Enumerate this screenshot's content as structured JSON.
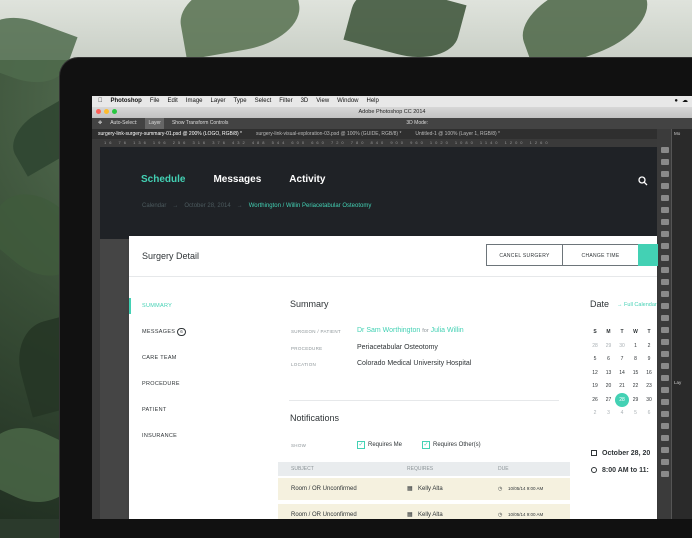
{
  "mac_menu": {
    "app": "Photoshop",
    "items": [
      "File",
      "Edit",
      "Image",
      "Layer",
      "Type",
      "Select",
      "Filter",
      "3D",
      "View",
      "Window",
      "Help"
    ]
  },
  "photoshop": {
    "window_title": "Adobe Photoshop CC 2014",
    "options": [
      "Auto-Select:",
      "Layer",
      "Show Transform Controls",
      "3D Mode:"
    ],
    "tabs": [
      "surgery-link-surgery-summary-01.psd @ 200% (LOGO, RGB/8) *",
      "surgery-link-visual-exploration-03.psd @ 100% (GUIDE, RGB/8) *",
      "Untitled-1 @ 100% (Layer 1, RGB/8) *"
    ],
    "ruler": "16 76 136 196 256 316 376 432 488 544 600 660 720 780 840 900 960 1020 1080 1140 1200 1260",
    "panel_labels": [
      "Mo",
      "Lay"
    ]
  },
  "app": {
    "nav": [
      {
        "label": "Schedule",
        "active": true
      },
      {
        "label": "Messages",
        "active": false
      },
      {
        "label": "Activity",
        "active": false
      }
    ],
    "breadcrumb": [
      "Calendar",
      "→",
      "October 28, 2014",
      "→",
      "Worthington / Willin Periacetabular Osteotomy"
    ],
    "card": {
      "title": "Surgery Detail",
      "buttons": {
        "cancel": "CANCEL SURGERY",
        "change": "CHANGE TIME"
      }
    },
    "sidebar": [
      {
        "label": "SUMMARY",
        "active": true
      },
      {
        "label": "MESSAGES",
        "badge": "6"
      },
      {
        "label": "CARE TEAM"
      },
      {
        "label": "PROCEDURE"
      },
      {
        "label": "PATIENT"
      },
      {
        "label": "INSURANCE"
      }
    ],
    "summary": {
      "title": "Summary",
      "surgeon_label": "SURGEON / PATIENT",
      "surgeon": "Dr Sam Worthington",
      "for": "for",
      "patient": "Julia Willin",
      "procedure_label": "PROCEDURE",
      "procedure": "Periacetabular Osteotomy",
      "location_label": "LOCATION",
      "location": "Colorado Medical University Hospital"
    },
    "notifications": {
      "title": "Notifications",
      "show_label": "SHOW",
      "opt1": "Requires Me",
      "opt2": "Requires Other(s)",
      "cols": [
        "SUBJECT",
        "REQUIRES",
        "DUE"
      ],
      "rows": [
        {
          "subject": "Room / OR Unconfirmed",
          "requires": "Kelly Alta",
          "due": "10/05/14 9:00 AM"
        },
        {
          "subject": "Room / OR Unconfirmed",
          "requires": "Kelly Alta",
          "due": "10/05/14 9:00 AM"
        }
      ]
    },
    "calendar": {
      "title": "Date",
      "link": "Full Calendar",
      "days": [
        "S",
        "M",
        "T",
        "W",
        "T"
      ],
      "weeks": [
        [
          "28",
          "29",
          "30",
          "1",
          "2"
        ],
        [
          "5",
          "6",
          "7",
          "8",
          "9"
        ],
        [
          "12",
          "13",
          "14",
          "15",
          "16"
        ],
        [
          "19",
          "20",
          "21",
          "22",
          "23"
        ],
        [
          "26",
          "27",
          "28",
          "29",
          "30"
        ],
        [
          "2",
          "3",
          "4",
          "5",
          "6"
        ]
      ],
      "date": "October 28, 20",
      "time": "8:00 AM to 11:"
    }
  }
}
